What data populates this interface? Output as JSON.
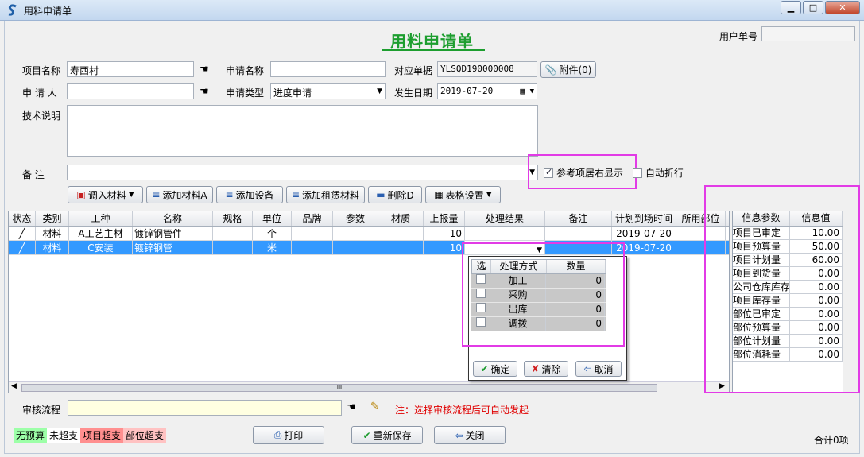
{
  "window": {
    "title": "用料申请单",
    "min": "▁",
    "max": "□",
    "close": "✕"
  },
  "form": {
    "title": "用料申请单",
    "user_no_label": "用户单号",
    "user_no_value": ""
  },
  "fields": {
    "project_name_label": "项目名称",
    "project_name_value": "寿西村",
    "apply_name_label": "申请名称",
    "apply_name_value": "",
    "ref_doc_label": "对应单据",
    "ref_doc_value": "YLSQD190000008",
    "attach_label": "附件(0)",
    "applicant_label": "申 请 人",
    "applicant_value": "",
    "apply_type_label": "申请类型",
    "apply_type_value": "进度申请",
    "date_label": "发生日期",
    "date_value": "2019-07-20",
    "tech_label": "技术说明",
    "tech_value": "",
    "remark_label": "备   注",
    "remark_value": "",
    "ref_right_label": "参考项居右显示",
    "auto_wrap_label": "自动折行"
  },
  "toolbar": {
    "import": "调入材料",
    "add_mat": "添加材料A",
    "add_equip": "添加设备",
    "add_rent": "添加租赁材料",
    "delete": "删除D",
    "table_set": "表格设置"
  },
  "grid": {
    "columns": [
      "状态",
      "类别",
      "工种",
      "名称",
      "规格",
      "单位",
      "品牌",
      "参数",
      "材质",
      "上报量",
      "处理结果",
      "备注",
      "计划到场时间",
      "所用部位"
    ],
    "rows": [
      {
        "status": "",
        "cat": "材料",
        "work": "A工艺主材",
        "name": "镀锌钢管件",
        "spec": "",
        "unit": "个",
        "brand": "",
        "param": "",
        "mat": "",
        "qty": "10",
        "result": "",
        "note": "",
        "date": "2019-07-20",
        "part": ""
      },
      {
        "status": "",
        "cat": "材料",
        "work": "C安装",
        "name": "镀锌钢管",
        "spec": "",
        "unit": "米",
        "brand": "",
        "param": "",
        "mat": "",
        "qty": "10",
        "result": "",
        "note": "",
        "date": "2019-07-20",
        "part": ""
      }
    ]
  },
  "popup": {
    "columns": [
      "选",
      "处理方式",
      "数量"
    ],
    "rows": [
      {
        "method": "加工",
        "qty": "0"
      },
      {
        "method": "采购",
        "qty": "0"
      },
      {
        "method": "出库",
        "qty": "0"
      },
      {
        "method": "调拨",
        "qty": "0"
      }
    ],
    "ok": "确定",
    "clear": "清除",
    "cancel": "取消"
  },
  "info": {
    "columns": [
      "信息参数",
      "信息值"
    ],
    "rows": [
      {
        "k": "项目已审定",
        "v": "10.00"
      },
      {
        "k": "项目预算量",
        "v": "50.00"
      },
      {
        "k": "项目计划量",
        "v": "60.00"
      },
      {
        "k": "项目到货量",
        "v": "0.00"
      },
      {
        "k": "公司仓库库存",
        "v": "0.00"
      },
      {
        "k": "项目库存量",
        "v": "0.00"
      },
      {
        "k": "部位已审定",
        "v": "0.00"
      },
      {
        "k": "部位预算量",
        "v": "0.00"
      },
      {
        "k": "部位计划量",
        "v": "0.00"
      },
      {
        "k": "部位消耗量",
        "v": "0.00"
      }
    ]
  },
  "approval": {
    "label": "审核流程",
    "value": "",
    "note": "注：选择审核流程后可自动发起"
  },
  "legend": {
    "none": "无预算",
    "under": "未超支",
    "proj_over": "项目超支",
    "part_over": "部位超支"
  },
  "bottom": {
    "print": "打印",
    "resave": "重新保存",
    "close": "关闭",
    "total": "合计0项"
  },
  "scroll": {
    "thumb": "III"
  },
  "colors": {
    "title_green": "#1d9e2f",
    "highlight": "#e23be6",
    "selected": "#3399ff",
    "note_red": "#e00000"
  }
}
